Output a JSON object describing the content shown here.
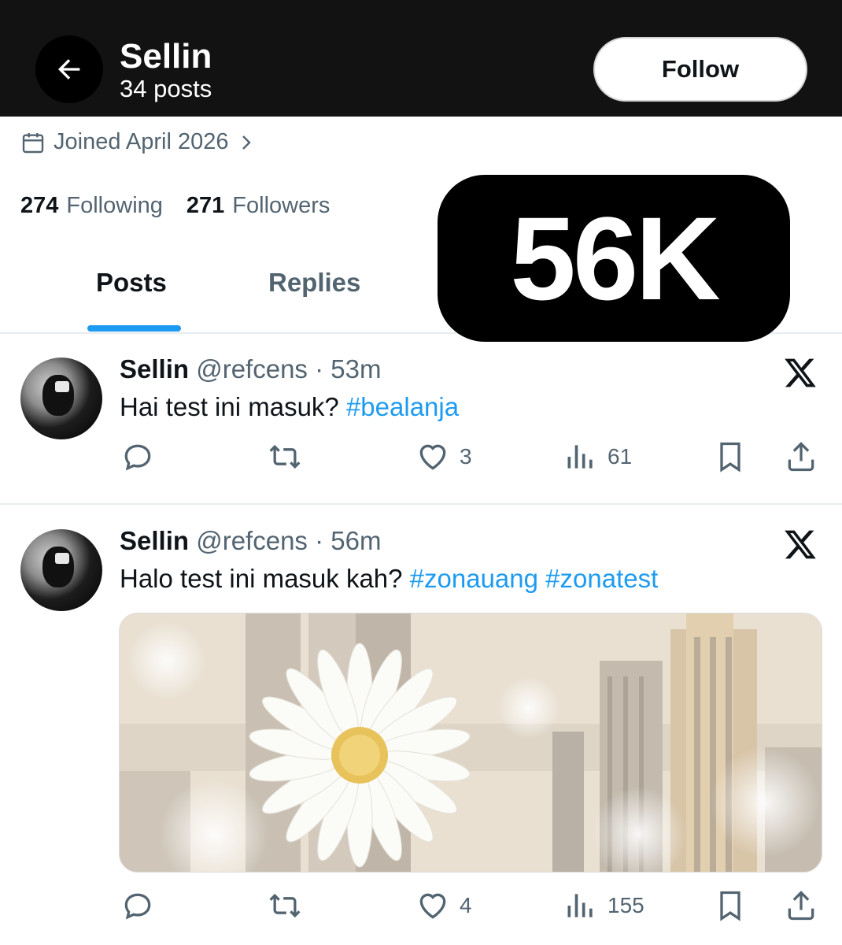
{
  "header": {
    "title": "Sellin",
    "subtitle": "34 posts",
    "follow_label": "Follow"
  },
  "profile": {
    "joined": "Joined April 2026",
    "following_count": "274",
    "following_label": "Following",
    "followers_count": "271",
    "followers_label": "Followers"
  },
  "tabs": [
    {
      "label": "Posts",
      "active": true
    },
    {
      "label": "Replies",
      "active": false
    }
  ],
  "badge": "56K",
  "colors": {
    "header_bg": "#121212",
    "accent": "#1d9bf0",
    "muted_text": "#536471"
  },
  "tweets": [
    {
      "name": "Sellin",
      "meta": "@refcens · 53m",
      "text": "Hai test ini masuk? ",
      "hashtags": "#bealanja",
      "likes": "3",
      "views": "61",
      "has_media": false
    },
    {
      "name": "Sellin",
      "meta": "@refcens · 56m",
      "text": "Halo test ini masuk kah? ",
      "hashtags": "#zonauang #zonatest",
      "likes": "4",
      "views": "155",
      "has_media": true
    }
  ],
  "icons": {
    "back": "arrow-left-icon",
    "calendar": "calendar-icon",
    "chevron": "chevron-right-icon",
    "x_logo": "x-logo-icon",
    "reply": "reply-icon",
    "retweet": "retweet-icon",
    "like": "heart-icon",
    "views": "views-icon",
    "bookmark": "bookmark-icon",
    "share": "share-icon"
  }
}
